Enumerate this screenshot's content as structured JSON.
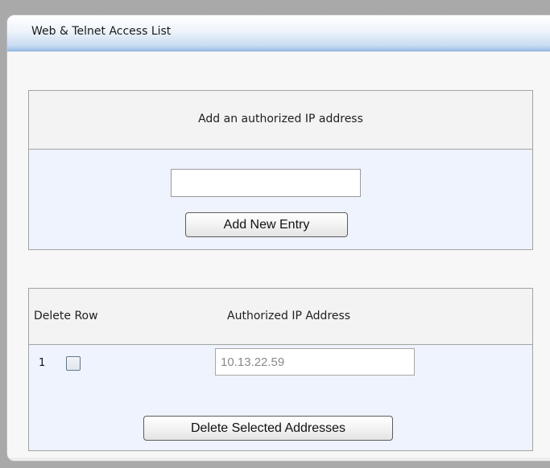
{
  "panel": {
    "title": "Web & Telnet Access List"
  },
  "add_section": {
    "heading": "Add an authorized IP address",
    "input_value": "",
    "add_button_label": "Add New Entry"
  },
  "list_section": {
    "columns": [
      "Delete Row",
      "Authorized IP Address"
    ],
    "rows": [
      {
        "index": "1",
        "checked": false,
        "ip": "10.13.22.59"
      }
    ],
    "delete_button_label": "Delete Selected Addresses"
  },
  "colors": {
    "header_gradient_bottom": "#9ec0e6",
    "section_body": "#eef3fd",
    "section_head": "#f3f3f3"
  }
}
